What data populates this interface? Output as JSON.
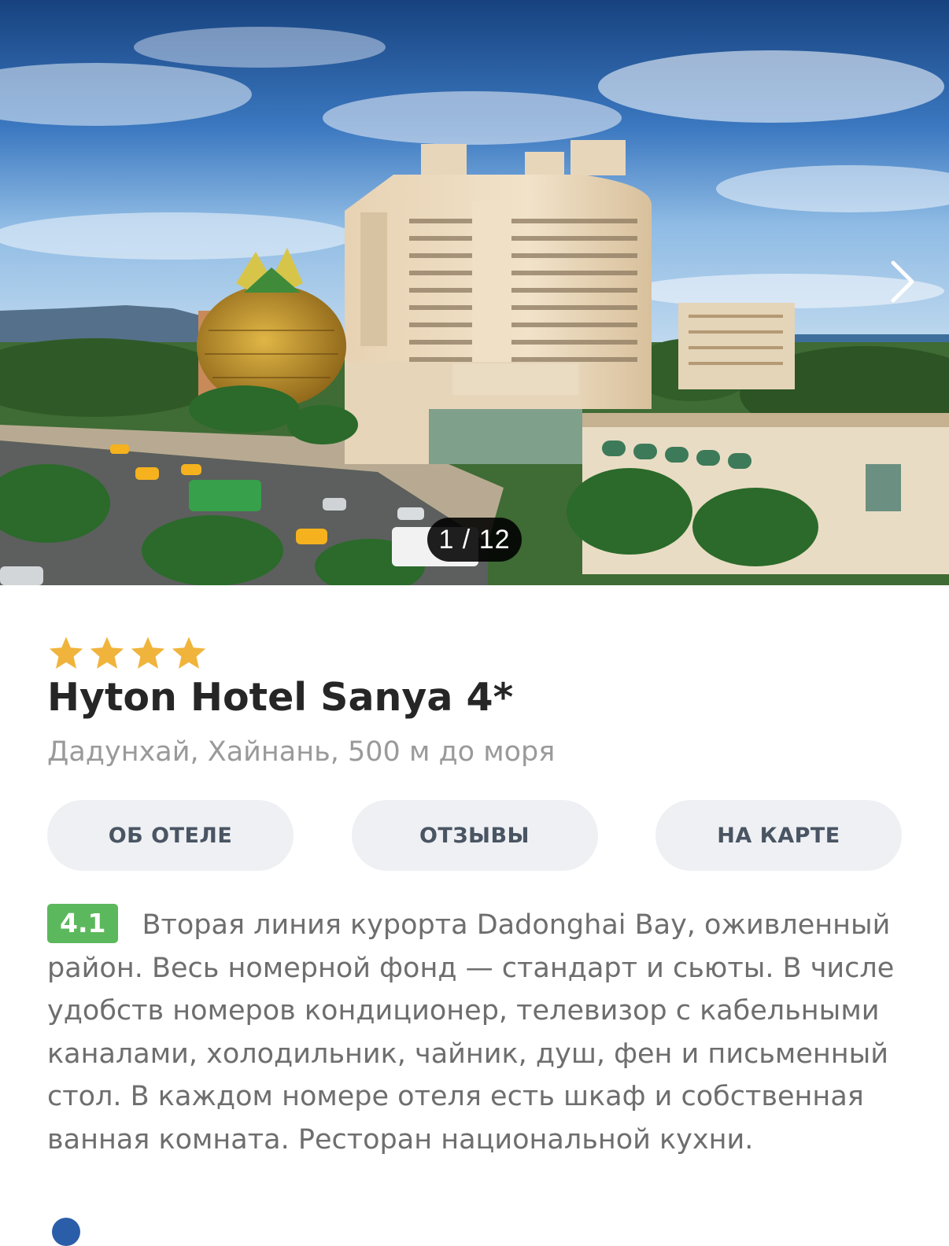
{
  "gallery": {
    "counter": "1 / 12",
    "current": 1,
    "total": 12,
    "next_icon": "chevron-right-icon"
  },
  "hotel": {
    "stars": 4,
    "star_color": "#f0b43c",
    "name": "Hyton Hotel Sanya 4*",
    "location": "Дадунхай, Хайнань, 500 м до моря"
  },
  "tabs": [
    {
      "label": "ОБ ОТЕЛЕ"
    },
    {
      "label": "ОТЗЫВЫ"
    },
    {
      "label": "НА КАРТЕ"
    }
  ],
  "rating": {
    "value": "4.1",
    "color": "#5cb85c"
  },
  "description": "Вторая линия курорта Dadonghai Bay, оживленный район. Весь номерной фонд — стандарт и сьюты. В числе удобств номеров кондиционер, телевизор с кабельными каналами, холодильник, чайник, душ, фен и письменный стол. В каждом номере отеля есть шкаф и собственная ванная комната. Ресторан национальной кухни."
}
